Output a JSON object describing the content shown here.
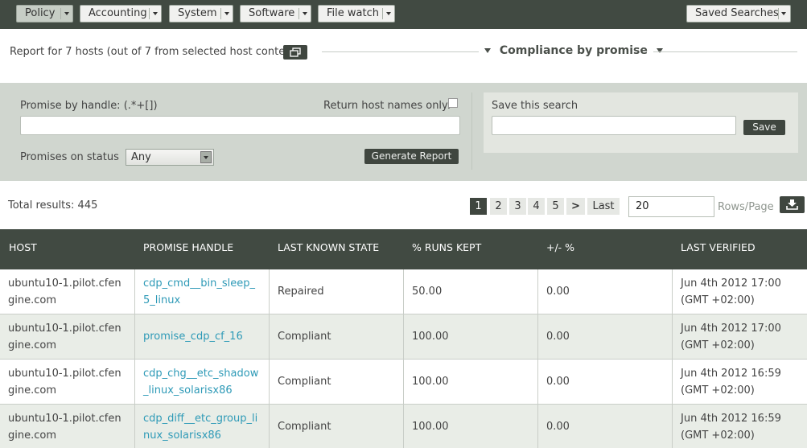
{
  "nav": {
    "items": [
      {
        "label": "Policy",
        "active": true
      },
      {
        "label": "Accounting",
        "active": false
      },
      {
        "label": "System",
        "active": false
      },
      {
        "label": "Software",
        "active": false
      },
      {
        "label": "File watch",
        "active": false
      }
    ],
    "saved_searches": "Saved Searches"
  },
  "report": {
    "host_text": "Report for 7 hosts (out of 7 from selected host context)",
    "report_type": "Compliance by promise"
  },
  "filters": {
    "handle_label": "Promise by handle: (.*+[])",
    "handle_value": "",
    "return_hostnames_label": "Return host names only:",
    "return_hostnames_checked": false,
    "status_label": "Promises on status",
    "status_value": "Any",
    "generate_label": "Generate Report",
    "save_search_label": "Save this search",
    "save_search_value": "",
    "save_label": "Save"
  },
  "results": {
    "total": "Total results: 445",
    "pages": [
      "1",
      "2",
      "3",
      "4",
      "5"
    ],
    "current_page": "1",
    "next": ">",
    "last": "Last",
    "rows_per_page": "20",
    "rows_per_page_label": "Rows/Page"
  },
  "table": {
    "headers": [
      "HOST",
      "PROMISE HANDLE",
      "LAST KNOWN STATE",
      "% RUNS KEPT",
      "+/- %",
      "LAST VERIFIED"
    ],
    "rows": [
      {
        "host": "ubuntu10-1.pilot.cfengine.com",
        "handle": "cdp_cmd__bin_sleep_5_linux",
        "state": "Repaired",
        "kept": "50.00",
        "delta": "0.00",
        "verified": "Jun 4th 2012 17:00 (GMT +02:00)"
      },
      {
        "host": "ubuntu10-1.pilot.cfengine.com",
        "handle": "promise_cdp_cf_16",
        "state": "Compliant",
        "kept": "100.00",
        "delta": "0.00",
        "verified": "Jun 4th 2012 17:00 (GMT +02:00)"
      },
      {
        "host": "ubuntu10-1.pilot.cfengine.com",
        "handle": "cdp_chg__etc_shadow_linux_solarisx86",
        "state": "Compliant",
        "kept": "100.00",
        "delta": "0.00",
        "verified": "Jun 4th 2012 16:59 (GMT +02:00)"
      },
      {
        "host": "ubuntu10-1.pilot.cfengine.com",
        "handle": "cdp_diff__etc_group_linux_solarisx86",
        "state": "Compliant",
        "kept": "100.00",
        "delta": "0.00",
        "verified": "Jun 4th 2012 16:59 (GMT +02:00)"
      }
    ]
  },
  "colors": {
    "nav_bg": "#414a42",
    "filter_bg": "#d0d6cf",
    "link": "#2e9ab7",
    "row_alt": "#e9ede7"
  }
}
